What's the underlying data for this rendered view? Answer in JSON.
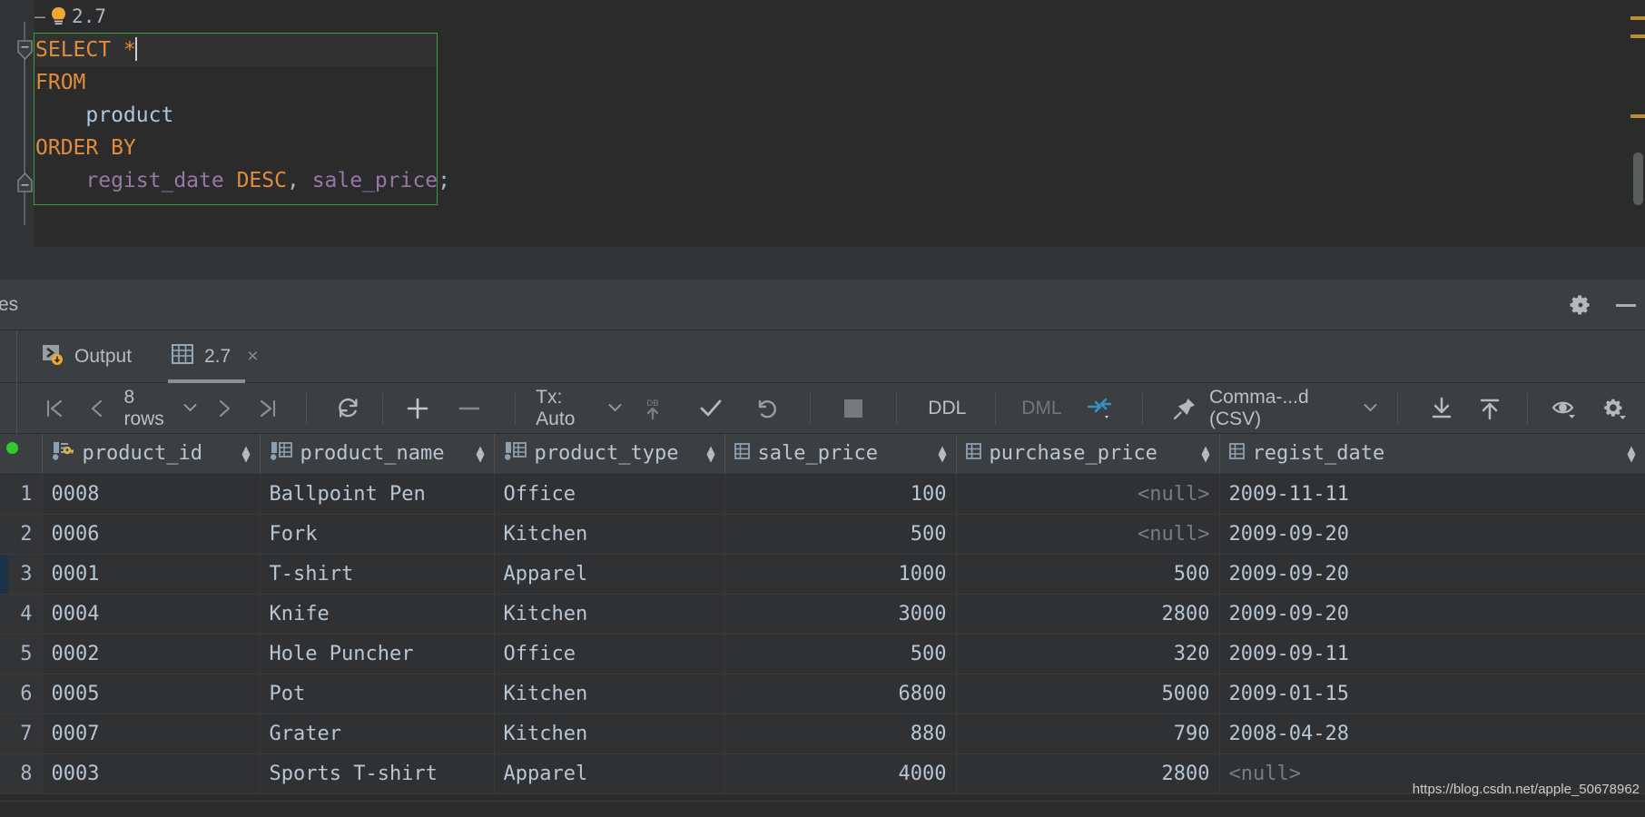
{
  "editor": {
    "hint_prefix": "–",
    "hint_icon": "lightbulb-icon",
    "hint_label": "2.7",
    "lines": [
      {
        "parts": [
          {
            "t": "SELECT",
            "c": "kw"
          },
          {
            "t": " ",
            "c": "pun"
          },
          {
            "t": "*",
            "c": "kw"
          }
        ],
        "caret": true,
        "current": true
      },
      {
        "parts": [
          {
            "t": "FROM",
            "c": "kw"
          }
        ],
        "caret": false,
        "current": false
      },
      {
        "parts": [
          {
            "t": "    ",
            "c": "pun"
          },
          {
            "t": "product",
            "c": "tbl"
          }
        ],
        "caret": false,
        "current": false
      },
      {
        "parts": [
          {
            "t": "ORDER BY",
            "c": "kw"
          }
        ],
        "caret": false,
        "current": false
      },
      {
        "parts": [
          {
            "t": "    ",
            "c": "pun"
          },
          {
            "t": "regist_date",
            "c": "col"
          },
          {
            "t": " ",
            "c": "pun"
          },
          {
            "t": "DESC",
            "c": "kw"
          },
          {
            "t": ",",
            "c": "pun"
          },
          {
            "t": " ",
            "c": "pun"
          },
          {
            "t": "sale_price",
            "c": "col"
          },
          {
            "t": ";",
            "c": "pun"
          }
        ],
        "caret": false,
        "current": false
      }
    ],
    "sql_text": "SELECT *\nFROM\n    product\nORDER BY\n    regist_date DESC, sale_price;"
  },
  "panel": {
    "title": "es",
    "settings_icon": "gear-icon",
    "minimize_icon": "minimize-icon"
  },
  "tabs": [
    {
      "label": "Output",
      "icon": "console-output-icon",
      "active": false,
      "closable": false
    },
    {
      "label": "2.7",
      "icon": "table-grid-icon",
      "active": true,
      "closable": true,
      "close_glyph": "×"
    }
  ],
  "toolbar": {
    "first_page_icon": "first-page-icon",
    "prev_page_icon": "prev-page-icon",
    "rows_label": "8 rows",
    "rows_chevron": "chevron-down-icon",
    "next_page_icon": "next-page-icon",
    "last_page_icon": "last-page-icon",
    "reload_icon": "refresh-icon",
    "add_row_icon": "plus-icon",
    "delete_row_icon": "minus-icon",
    "tx_label": "Tx: Auto",
    "tx_chevron": "chevron-down-icon",
    "db_upload_icon": "db-submit-icon",
    "commit_icon": "checkmark-icon",
    "rollback_icon": "revert-icon",
    "stop_icon": "stop-icon",
    "ddl_label": "DDL",
    "dml_label": "DML",
    "data_extractor_icon": "transpose-icon",
    "pin_icon": "pin-icon",
    "format_label": "Comma-...d (CSV)",
    "format_chevron": "chevron-down-icon",
    "download_icon": "download-icon",
    "upload_icon": "upload-icon",
    "view_icon": "eye-icon",
    "settings_icon": "gear-icon"
  },
  "grid": {
    "columns": [
      {
        "name": "product_id",
        "icon": "primary-key-icon",
        "sortable": true,
        "align": "left"
      },
      {
        "name": "product_name",
        "icon": "column-icon",
        "sortable": true,
        "align": "left"
      },
      {
        "name": "product_type",
        "icon": "column-icon",
        "sortable": true,
        "align": "left"
      },
      {
        "name": "sale_price",
        "icon": "column-icon",
        "sortable": true,
        "align": "right"
      },
      {
        "name": "purchase_price",
        "icon": "column-icon",
        "sortable": true,
        "align": "right"
      },
      {
        "name": "regist_date",
        "icon": "column-icon",
        "sortable": true,
        "align": "left"
      }
    ],
    "rows": [
      {
        "n": "1",
        "product_id": "0008",
        "product_name": "Ballpoint Pen",
        "product_type": "Office",
        "sale_price": "100",
        "purchase_price": "<null>",
        "regist_date": "2009-11-11",
        "selected": false
      },
      {
        "n": "2",
        "product_id": "0006",
        "product_name": "Fork",
        "product_type": "Kitchen",
        "sale_price": "500",
        "purchase_price": "<null>",
        "regist_date": "2009-09-20",
        "selected": false
      },
      {
        "n": "3",
        "product_id": "0001",
        "product_name": "T-shirt",
        "product_type": "Apparel",
        "sale_price": "1000",
        "purchase_price": "500",
        "regist_date": "2009-09-20",
        "selected": true
      },
      {
        "n": "4",
        "product_id": "0004",
        "product_name": "Knife",
        "product_type": "Kitchen",
        "sale_price": "3000",
        "purchase_price": "2800",
        "regist_date": "2009-09-20",
        "selected": false
      },
      {
        "n": "5",
        "product_id": "0002",
        "product_name": "Hole Puncher",
        "product_type": "Office",
        "sale_price": "500",
        "purchase_price": "320",
        "regist_date": "2009-09-11",
        "selected": false
      },
      {
        "n": "6",
        "product_id": "0005",
        "product_name": "Pot",
        "product_type": "Kitchen",
        "sale_price": "6800",
        "purchase_price": "5000",
        "regist_date": "2009-01-15",
        "selected": false
      },
      {
        "n": "7",
        "product_id": "0007",
        "product_name": "Grater",
        "product_type": "Kitchen",
        "sale_price": "880",
        "purchase_price": "790",
        "regist_date": "2008-04-28",
        "selected": false
      },
      {
        "n": "8",
        "product_id": "0003",
        "product_name": "Sports T-shirt",
        "product_type": "Apparel",
        "sale_price": "4000",
        "purchase_price": "2800",
        "regist_date": "<null>",
        "selected": false
      }
    ],
    "row_count": 8
  },
  "watermark": "https://blog.csdn.net/apple_50678962",
  "colors": {
    "bg_editor": "#2b2b2b",
    "bg_panel": "#3c3f41",
    "keyword": "#e08c3c",
    "table_name": "#a9c7e0",
    "column_name": "#9876aa",
    "selection_border": "#3c9b3c",
    "accent_blue": "#3592c4",
    "status_green": "#2ecc2e",
    "marker_yellow": "#b89030",
    "key_gold": "#d5b052"
  }
}
